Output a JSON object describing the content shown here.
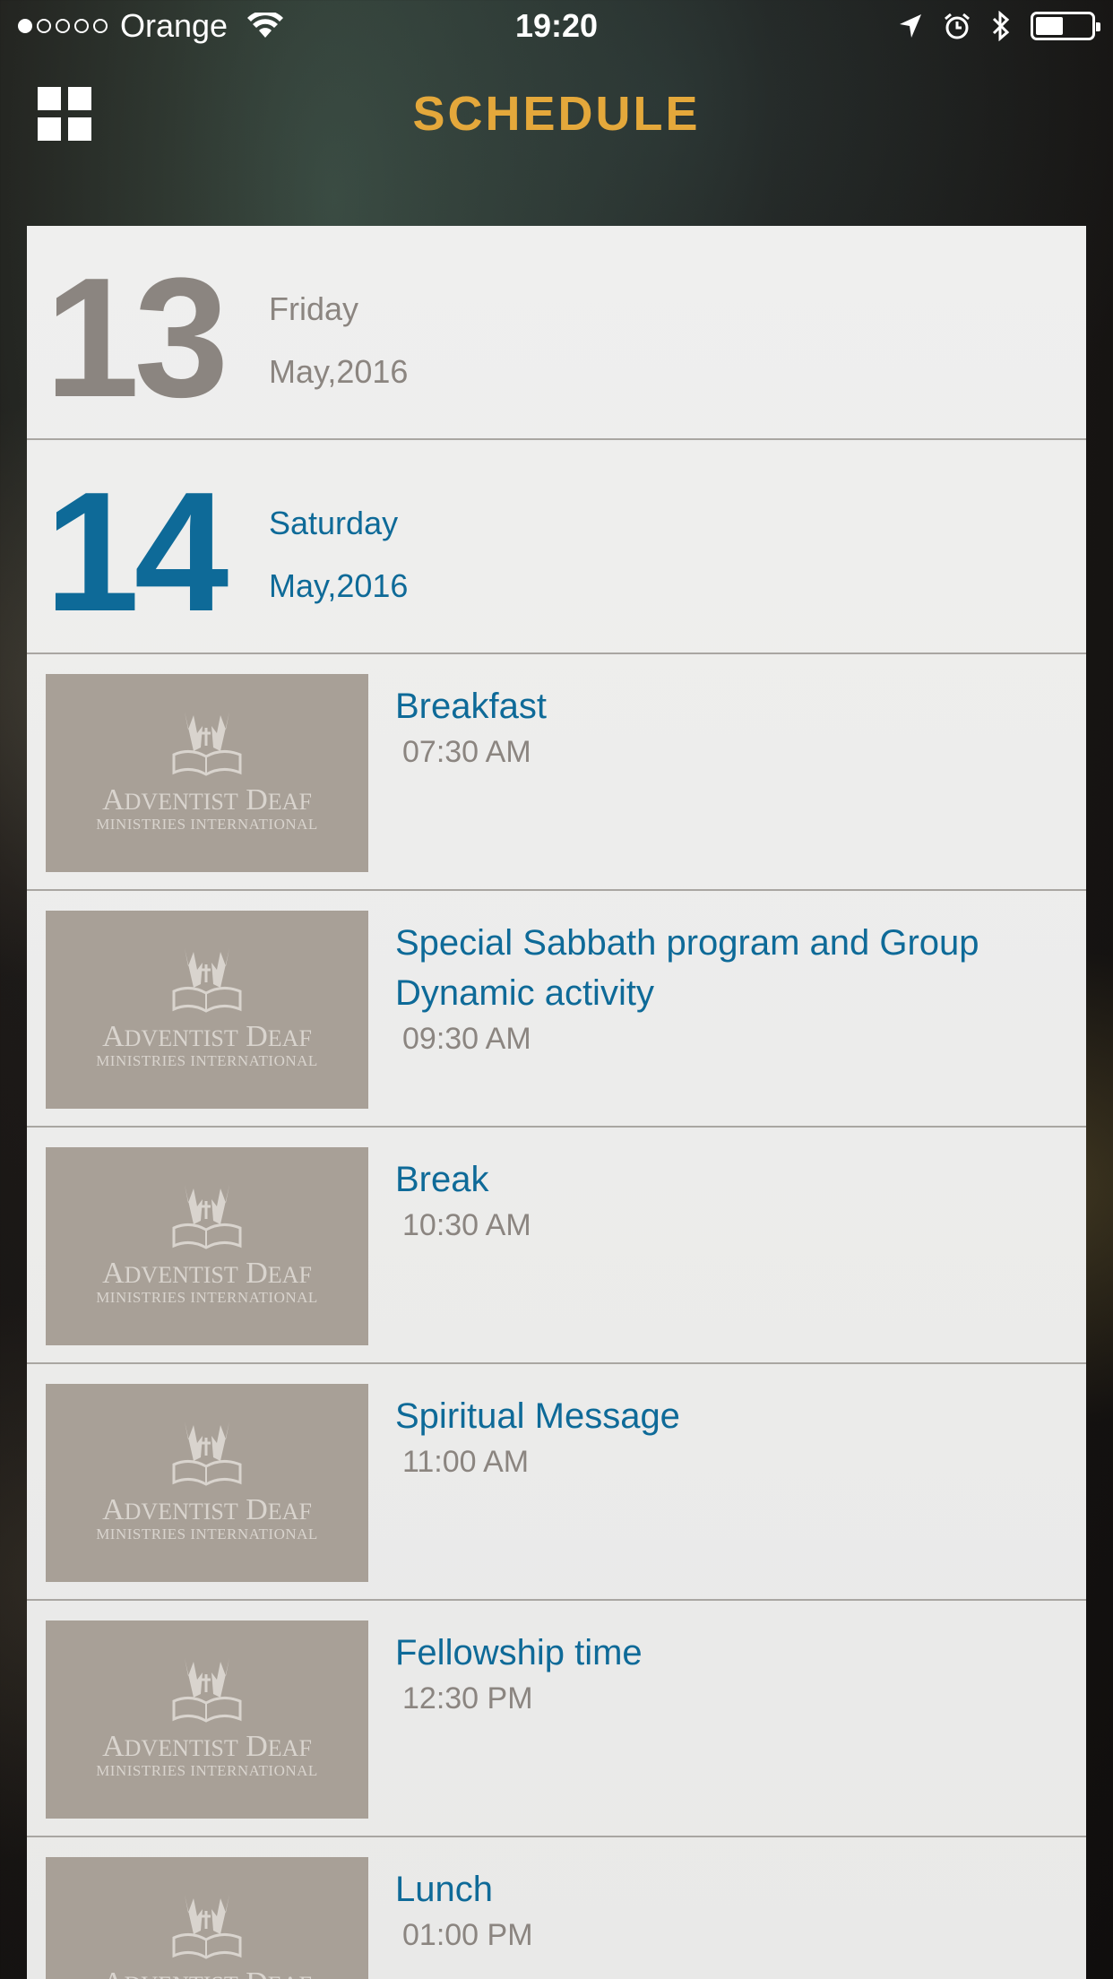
{
  "status_bar": {
    "carrier": "Orange",
    "time": "19:20",
    "signal_bars_filled": 1,
    "signal_bars_total": 5,
    "battery_level": 0.45
  },
  "nav": {
    "title": "SCHEDULE",
    "menu_icon": "grid-icon"
  },
  "dates": [
    {
      "day_number": "13",
      "weekday": "Friday",
      "month_year": "May,2016",
      "state": "past"
    },
    {
      "day_number": "14",
      "weekday": "Saturday",
      "month_year": "May,2016",
      "state": "active"
    }
  ],
  "thumbnail": {
    "line1_big1": "A",
    "line1_small1": "DVENTIST",
    "line1_big2": "D",
    "line1_small2": "EAF",
    "line2": "MINISTRIES INTERNATIONAL"
  },
  "events": [
    {
      "title": "Breakfast",
      "time": "07:30 AM"
    },
    {
      "title": "Special Sabbath program and Group Dynamic activity",
      "time": "09:30 AM"
    },
    {
      "title": "Break",
      "time": "10:30 AM"
    },
    {
      "title": "Spiritual Message",
      "time": "11:00 AM"
    },
    {
      "title": "Fellowship time",
      "time": "12:30 PM"
    },
    {
      "title": "Lunch",
      "time": "01:00 PM"
    }
  ],
  "colors": {
    "accent_title": "#e4a83b",
    "active_blue": "#0e6a98",
    "muted_gray": "#8b8580"
  }
}
